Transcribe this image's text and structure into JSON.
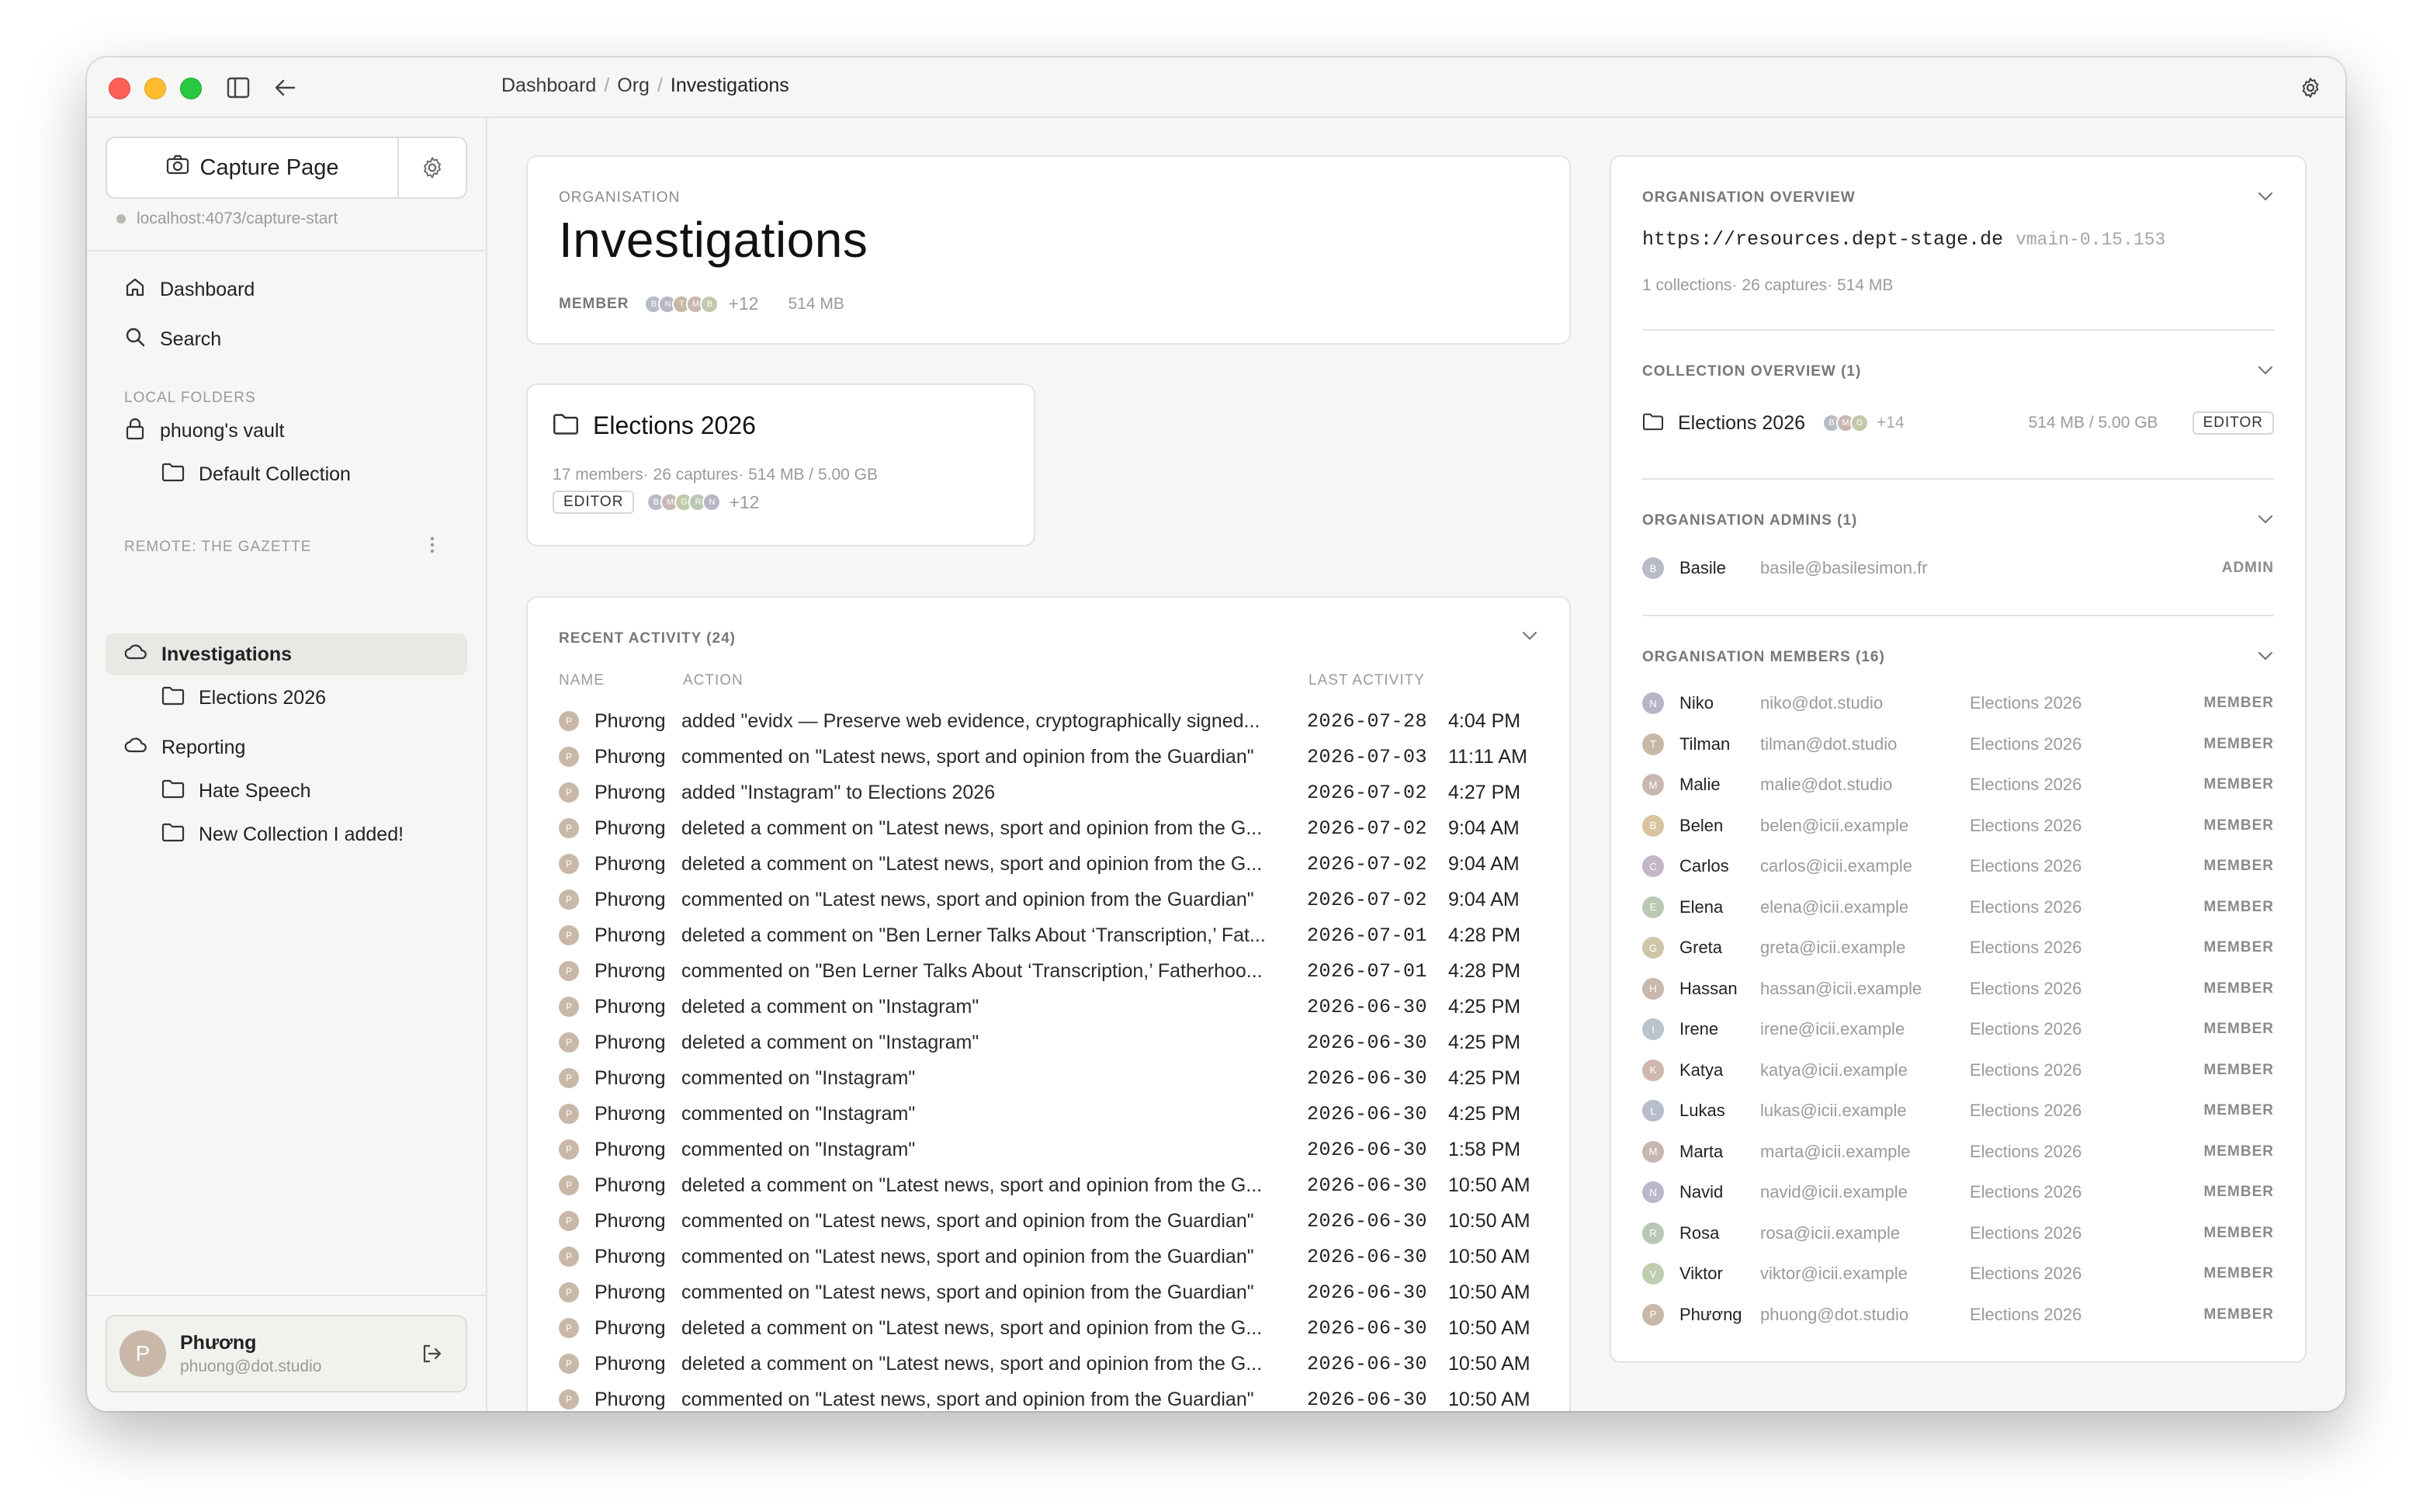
{
  "breadcrumb": [
    "Dashboard",
    "Org",
    "Investigations"
  ],
  "sidebar": {
    "capture_label": "Capture Page",
    "capture_url": "localhost:4073/capture-start",
    "nav": [
      {
        "label": "Dashboard",
        "icon": "home-icon"
      },
      {
        "label": "Search",
        "icon": "search-icon"
      }
    ],
    "local_section": "LOCAL FOLDERS",
    "vault_label": "phuong's vault",
    "default_collection": "Default Collection",
    "remote_section": "REMOTE: THE GAZETTE",
    "investigations": "Investigations",
    "elections": "Elections 2026",
    "reporting": "Reporting",
    "hate_speech": "Hate Speech",
    "new_collection": "New Collection I added!",
    "user": {
      "initial": "P",
      "name": "Phương",
      "email": "phuong@dot.studio"
    }
  },
  "org": {
    "label": "ORGANISATION",
    "title": "Investigations",
    "role": "MEMBER",
    "avatars": [
      "B",
      "N",
      "T",
      "M",
      "B"
    ],
    "more": "+12",
    "size": "514 MB"
  },
  "collection_card": {
    "title": "Elections 2026",
    "meta": "17 members· 26 captures· 514 MB / 5.00 GB",
    "role": "EDITOR",
    "avatars": [
      "B",
      "M",
      "G",
      "R",
      "N"
    ],
    "more": "+12"
  },
  "activity": {
    "title": "RECENT ACTIVITY (24)",
    "cols": {
      "name": "NAME",
      "action": "ACTION",
      "last": "LAST ACTIVITY"
    },
    "rows": [
      {
        "name": "Phương",
        "action": "added \"evidx — Preserve web evidence, cryptographically signed...",
        "date": "2026-07-28",
        "time": "4:04 PM"
      },
      {
        "name": "Phương",
        "action": "commented on \"Latest news, sport and opinion from the Guardian\"",
        "date": "2026-07-03",
        "time": "11:11 AM"
      },
      {
        "name": "Phương",
        "action": "added \"Instagram\" to Elections 2026",
        "date": "2026-07-02",
        "time": "4:27 PM"
      },
      {
        "name": "Phương",
        "action": "deleted a comment on \"Latest news, sport and opinion from the G...",
        "date": "2026-07-02",
        "time": "9:04 AM"
      },
      {
        "name": "Phương",
        "action": "deleted a comment on \"Latest news, sport and opinion from the G...",
        "date": "2026-07-02",
        "time": "9:04 AM"
      },
      {
        "name": "Phương",
        "action": "commented on \"Latest news, sport and opinion from the Guardian\"",
        "date": "2026-07-02",
        "time": "9:04 AM"
      },
      {
        "name": "Phương",
        "action": "deleted a comment on \"Ben Lerner Talks About ‘Transcription,’ Fat...",
        "date": "2026-07-01",
        "time": "4:28 PM"
      },
      {
        "name": "Phương",
        "action": "commented on \"Ben Lerner Talks About ‘Transcription,’ Fatherhoo...",
        "date": "2026-07-01",
        "time": "4:28 PM"
      },
      {
        "name": "Phương",
        "action": "deleted a comment on \"Instagram\"",
        "date": "2026-06-30",
        "time": "4:25 PM"
      },
      {
        "name": "Phương",
        "action": "deleted a comment on \"Instagram\"",
        "date": "2026-06-30",
        "time": "4:25 PM"
      },
      {
        "name": "Phương",
        "action": "commented on \"Instagram\"",
        "date": "2026-06-30",
        "time": "4:25 PM"
      },
      {
        "name": "Phương",
        "action": "commented on \"Instagram\"",
        "date": "2026-06-30",
        "time": "4:25 PM"
      },
      {
        "name": "Phương",
        "action": "commented on \"Instagram\"",
        "date": "2026-06-30",
        "time": "1:58 PM"
      },
      {
        "name": "Phương",
        "action": "deleted a comment on \"Latest news, sport and opinion from the G...",
        "date": "2026-06-30",
        "time": "10:50 AM"
      },
      {
        "name": "Phương",
        "action": "commented on \"Latest news, sport and opinion from the Guardian\"",
        "date": "2026-06-30",
        "time": "10:50 AM"
      },
      {
        "name": "Phương",
        "action": "commented on \"Latest news, sport and opinion from the Guardian\"",
        "date": "2026-06-30",
        "time": "10:50 AM"
      },
      {
        "name": "Phương",
        "action": "commented on \"Latest news, sport and opinion from the Guardian\"",
        "date": "2026-06-30",
        "time": "10:50 AM"
      },
      {
        "name": "Phương",
        "action": "deleted a comment on \"Latest news, sport and opinion from the G...",
        "date": "2026-06-30",
        "time": "10:50 AM"
      },
      {
        "name": "Phương",
        "action": "deleted a comment on \"Latest news, sport and opinion from the G...",
        "date": "2026-06-30",
        "time": "10:50 AM"
      },
      {
        "name": "Phương",
        "action": "commented on \"Latest news, sport and opinion from the Guardian\"",
        "date": "2026-06-30",
        "time": "10:50 AM"
      }
    ]
  },
  "overview": {
    "title": "ORGANISATION OVERVIEW",
    "url": "https://resources.dept-stage.de",
    "version": "vmain-0.15.153",
    "stats": "1 collections· 26 captures· 514 MB",
    "collection_title": "COLLECTION OVERVIEW (1)",
    "collection_name": "Elections 2026",
    "collection_avatars": [
      "B",
      "M",
      "G"
    ],
    "collection_more": "+14",
    "collection_size": "514 MB / 5.00 GB",
    "collection_role": "EDITOR",
    "admins_title": "ORGANISATION ADMINS (1)",
    "admin": {
      "initial": "B",
      "name": "Basile",
      "email": "basile@basilesimon.fr",
      "role": "ADMIN"
    },
    "members_title": "ORGANISATION MEMBERS (16)",
    "members": [
      {
        "initial": "N",
        "name": "Niko",
        "email": "niko@dot.studio",
        "coll": "Elections 2026",
        "role": "MEMBER",
        "color": "#b6b7c6"
      },
      {
        "initial": "T",
        "name": "Tilman",
        "email": "tilman@dot.studio",
        "coll": "Elections 2026",
        "role": "MEMBER",
        "color": "#c8b8a6"
      },
      {
        "initial": "M",
        "name": "Malie",
        "email": "malie@dot.studio",
        "coll": "Elections 2026",
        "role": "MEMBER",
        "color": "#c8b7b2"
      },
      {
        "initial": "B",
        "name": "Belen",
        "email": "belen@icii.example",
        "coll": "Elections 2026",
        "role": "MEMBER",
        "color": "#d8c59f"
      },
      {
        "initial": "C",
        "name": "Carlos",
        "email": "carlos@icii.example",
        "coll": "Elections 2026",
        "role": "MEMBER",
        "color": "#c4b6c9"
      },
      {
        "initial": "E",
        "name": "Elena",
        "email": "elena@icii.example",
        "coll": "Elections 2026",
        "role": "MEMBER",
        "color": "#b9c9b3"
      },
      {
        "initial": "G",
        "name": "Greta",
        "email": "greta@icii.example",
        "coll": "Elections 2026",
        "role": "MEMBER",
        "color": "#cfc6a7"
      },
      {
        "initial": "H",
        "name": "Hassan",
        "email": "hassan@icii.example",
        "coll": "Elections 2026",
        "role": "MEMBER",
        "color": "#c9b8ae"
      },
      {
        "initial": "I",
        "name": "Irene",
        "email": "irene@icii.example",
        "coll": "Elections 2026",
        "role": "MEMBER",
        "color": "#b9c4cd"
      },
      {
        "initial": "K",
        "name": "Katya",
        "email": "katya@icii.example",
        "coll": "Elections 2026",
        "role": "MEMBER",
        "color": "#cdb8ae"
      },
      {
        "initial": "L",
        "name": "Lukas",
        "email": "lukas@icii.example",
        "coll": "Elections 2026",
        "role": "MEMBER",
        "color": "#b8bdcc"
      },
      {
        "initial": "M",
        "name": "Marta",
        "email": "marta@icii.example",
        "coll": "Elections 2026",
        "role": "MEMBER",
        "color": "#c6b7b3"
      },
      {
        "initial": "N",
        "name": "Navid",
        "email": "navid@icii.example",
        "coll": "Elections 2026",
        "role": "MEMBER",
        "color": "#b8b9cb"
      },
      {
        "initial": "R",
        "name": "Rosa",
        "email": "rosa@icii.example",
        "coll": "Elections 2026",
        "role": "MEMBER",
        "color": "#b9c7b5"
      },
      {
        "initial": "V",
        "name": "Viktor",
        "email": "viktor@icii.example",
        "coll": "Elections 2026",
        "role": "MEMBER",
        "color": "#bfcdb0"
      },
      {
        "initial": "P",
        "name": "Phương",
        "email": "phuong@dot.studio",
        "coll": "Elections 2026",
        "role": "MEMBER",
        "color": "#c9b8a8"
      }
    ]
  }
}
